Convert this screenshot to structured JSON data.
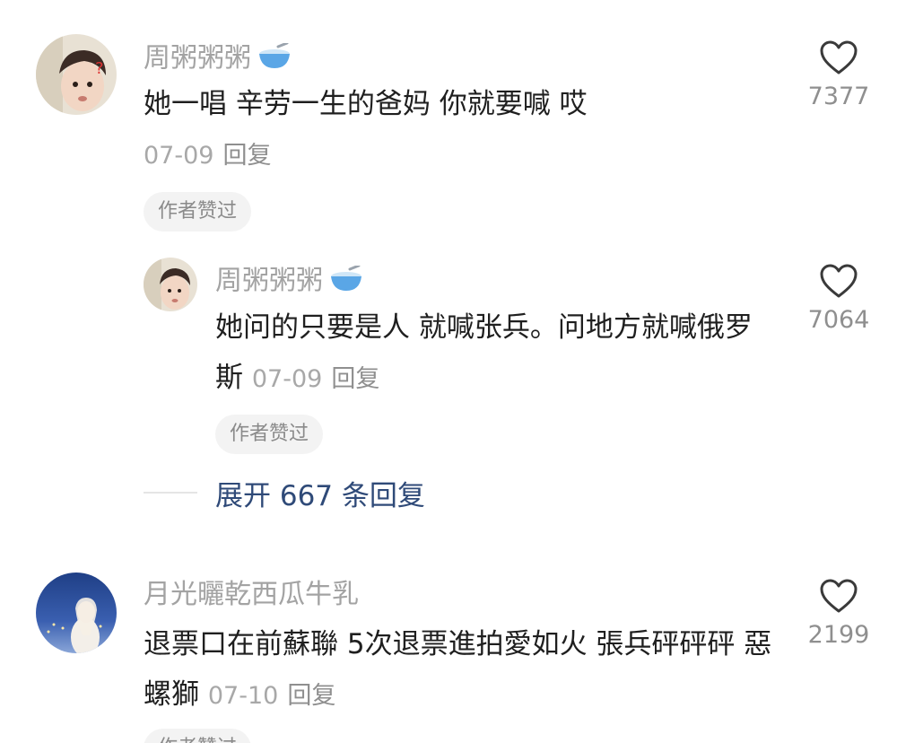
{
  "comments": [
    {
      "username": "周粥粥粥",
      "text": "她一唱 辛劳一生的爸妈 你就要喊 哎",
      "date": "07-09",
      "reply_label": "回复",
      "badge": "作者赞过",
      "likes": "7377"
    },
    {
      "username": "周粥粥粥",
      "text": "她问的只要是人 就喊张兵。问地方就喊俄罗斯",
      "date": "07-09",
      "reply_label": "回复",
      "badge": "作者赞过",
      "likes": "7064"
    },
    {
      "username": "月光曬乾西瓜牛乳",
      "text": "退票口在前蘇聯 5次退票進拍愛如火 張兵砰砰砰 惡螺獅",
      "date": "07-10",
      "reply_label": "回复",
      "badge": "作者赞过",
      "likes": "2199"
    }
  ],
  "expand_replies": "展开 667 条回复",
  "colors": {
    "username": "#a3a3a3",
    "text": "#1f1f1f",
    "meta": "#a8a8a8",
    "link": "#2f4a78",
    "badge_bg": "#f3f3f3"
  },
  "icons": {
    "like": "heart-outline-icon",
    "username_emoji": "bowl-spoon-emoji-icon"
  }
}
